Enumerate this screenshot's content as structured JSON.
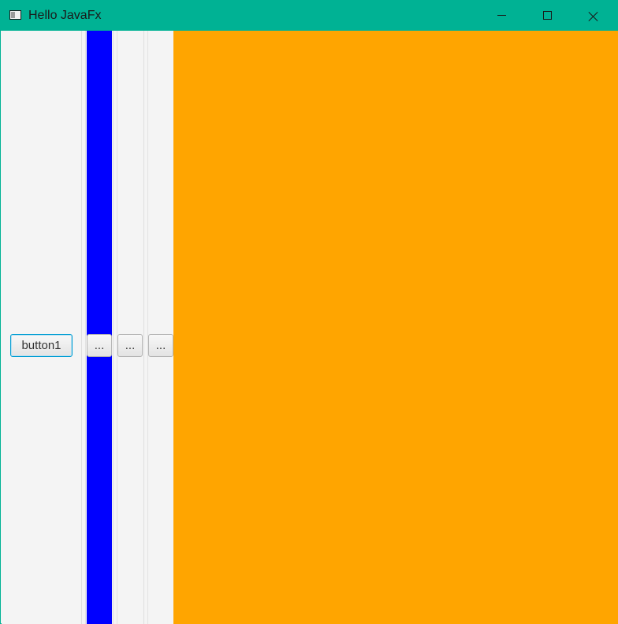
{
  "window": {
    "title": "Hello JavaFx",
    "icons": {
      "app": "app-window-icon",
      "minimize": "minimize-icon",
      "maximize": "maximize-icon",
      "close": "close-icon"
    }
  },
  "colors": {
    "titlebar": "#00b294",
    "background": "#f4f4f4",
    "blue_pane": "#0000ff",
    "orange_pane": "#ffa500",
    "focus_border": "#039ed3"
  },
  "panes": {
    "left": {
      "button_label": "button1"
    },
    "blue": {
      "button_label": "..."
    },
    "plain2": {
      "button_label": "..."
    },
    "plain3": {
      "button_label": "..."
    }
  }
}
